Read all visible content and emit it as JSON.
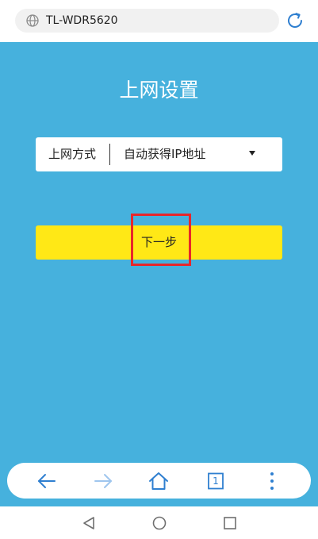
{
  "browser": {
    "url": "TL-WDR5620",
    "icons": {
      "site": "globe-icon",
      "reload": "refresh-icon"
    }
  },
  "page": {
    "title": "上网设置",
    "connection": {
      "label": "上网方式",
      "value": "自动获得IP地址"
    },
    "next_button": "下一步"
  },
  "toolbar": {
    "tab_count": "1",
    "icons": [
      "back-arrow-icon",
      "forward-arrow-icon",
      "home-icon",
      "tabs-icon",
      "more-icon"
    ]
  },
  "nav": {
    "icons": [
      "back-triangle-icon",
      "home-circle-icon",
      "recents-square-icon"
    ]
  },
  "colors": {
    "background": "#46b1dd",
    "accent_button": "#ffe816",
    "highlight": "#e8262a",
    "toolbar_icon": "#2f7fd0"
  }
}
